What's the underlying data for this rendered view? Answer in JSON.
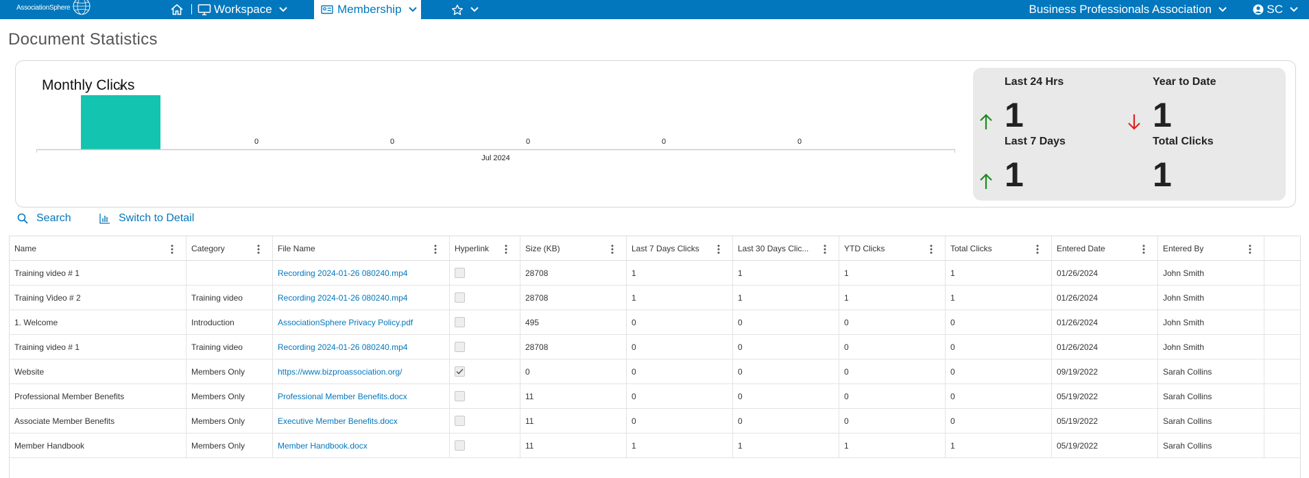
{
  "nav": {
    "logo_text": "AssociationSphere",
    "workspace_label": "Workspace",
    "membership_label": "Membership",
    "org_label": "Business Professionals Association",
    "user_initials": "SC"
  },
  "page_title": "Document Statistics",
  "chart": {
    "title": "Monthly Clicks"
  },
  "chart_data": {
    "type": "bar",
    "title": "Monthly Clicks",
    "categories": [
      "",
      "",
      "Jul 2024",
      "",
      "",
      ""
    ],
    "values": [
      1,
      0,
      0,
      0,
      0,
      0
    ],
    "xlabel": "",
    "ylabel": "",
    "ylim": [
      0,
      1
    ],
    "grid": false,
    "bar_color": "#13c4b0"
  },
  "stats": {
    "last24_label": "Last 24 Hrs",
    "last24_value": "1",
    "last24_trend": "up",
    "ytd_label": "Year to Date",
    "ytd_value": "1",
    "ytd_trend": "down",
    "last7_label": "Last 7 Days",
    "last7_value": "1",
    "last7_trend": "up",
    "total_label": "Total Clicks",
    "total_value": "1",
    "up_color": "#1e8a1e",
    "down_color": "#e02020"
  },
  "toolbar": {
    "search_label": "Search",
    "switch_label": "Switch to Detail"
  },
  "table": {
    "columns": [
      "Name",
      "Category",
      "File Name",
      "Hyperlink",
      "Size (KB)",
      "Last 7 Days Clicks",
      "Last 30 Days Clic...",
      "YTD Clicks",
      "Total Clicks",
      "Entered Date",
      "Entered By"
    ],
    "rows": [
      {
        "name": "Training video # 1",
        "category": "",
        "file": "Recording 2024-01-26 080240.mp4",
        "hyperlink": false,
        "size": "28708",
        "last7": "1",
        "last30": "1",
        "ytd": "1",
        "total": "1",
        "date": "01/26/2024",
        "by": "John Smith"
      },
      {
        "name": "Training Video # 2",
        "category": "Training video",
        "file": "Recording 2024-01-26 080240.mp4",
        "hyperlink": false,
        "size": "28708",
        "last7": "1",
        "last30": "1",
        "ytd": "1",
        "total": "1",
        "date": "01/26/2024",
        "by": "John Smith"
      },
      {
        "name": "1. Welcome",
        "category": "Introduction",
        "file": "AssociationSphere Privacy Policy.pdf",
        "hyperlink": false,
        "size": "495",
        "last7": "0",
        "last30": "0",
        "ytd": "0",
        "total": "0",
        "date": "01/26/2024",
        "by": "John Smith"
      },
      {
        "name": "Training video # 1",
        "category": "Training video",
        "file": "Recording 2024-01-26 080240.mp4",
        "hyperlink": false,
        "size": "28708",
        "last7": "0",
        "last30": "0",
        "ytd": "0",
        "total": "0",
        "date": "01/26/2024",
        "by": "John Smith"
      },
      {
        "name": "Website",
        "category": "Members Only",
        "file": "https://www.bizproassociation.org/",
        "hyperlink": true,
        "size": "0",
        "last7": "0",
        "last30": "0",
        "ytd": "0",
        "total": "0",
        "date": "09/19/2022",
        "by": "Sarah Collins"
      },
      {
        "name": "Professional Member Benefits",
        "category": "Members Only",
        "file": "Professional Member Benefits.docx",
        "hyperlink": false,
        "size": "11",
        "last7": "0",
        "last30": "0",
        "ytd": "0",
        "total": "0",
        "date": "05/19/2022",
        "by": "Sarah Collins"
      },
      {
        "name": "Associate Member Benefits",
        "category": "Members Only",
        "file": "Executive Member Benefits.docx",
        "hyperlink": false,
        "size": "11",
        "last7": "0",
        "last30": "0",
        "ytd": "0",
        "total": "0",
        "date": "05/19/2022",
        "by": "Sarah Collins"
      },
      {
        "name": "Member Handbook",
        "category": "Members Only",
        "file": "Member Handbook.docx",
        "hyperlink": false,
        "size": "11",
        "last7": "1",
        "last30": "1",
        "ytd": "1",
        "total": "1",
        "date": "05/19/2022",
        "by": "Sarah Collins"
      }
    ]
  }
}
